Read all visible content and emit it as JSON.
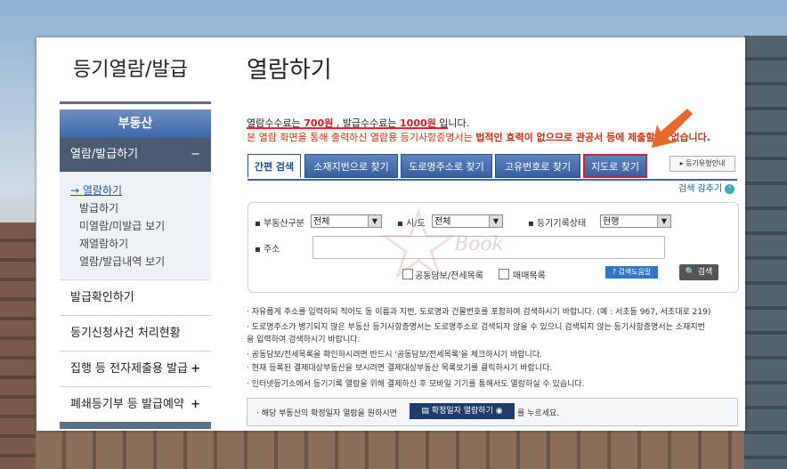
{
  "sidebar": {
    "title": "등기열람/발급",
    "header": "부동산",
    "active_item": "열람/발급하기",
    "active_toggle": "−",
    "sub_items": [
      "열람하기",
      "발급하기",
      "미열람/미발급 보기",
      "재열람하기",
      "열람/발급내역 보기"
    ],
    "items": [
      {
        "label": "발급확인하기",
        "toggle": ""
      },
      {
        "label": "등기신청사건 처리현황",
        "toggle": ""
      },
      {
        "label": "집행 등 전자제출용 발급",
        "toggle": "+"
      },
      {
        "label": "폐쇄등기부 등 발급예약",
        "toggle": "+"
      }
    ]
  },
  "main": {
    "title": "열람하기",
    "fee": {
      "p1": "열람수수료는 ",
      "v1": "700원",
      "p2": " , 발급수수료는 ",
      "v2": "1000원",
      "p3": " 입니다."
    },
    "notice": {
      "p1": "본 열람 화면을 통해 출력하신 열람용 등기사항증명서는 ",
      "b": "법적인 효력이 없으므로 관공서 등에 제출할 수 없습니다."
    },
    "tabs": [
      "간편 검색",
      "소재지번으로 찾기",
      "도로명주소로 찾기",
      "고유번호로 찾기",
      "지도로 찾기"
    ],
    "help_button": "등기유형안내",
    "collapse_label": "검색 감추기",
    "form": {
      "type_label": "부동산구분",
      "type_value": "전체",
      "city_label": "시/도",
      "city_value": "전체",
      "status_label": "등기기록상태",
      "status_value": "현행",
      "address_label": "주소",
      "address_value": "",
      "check1": "공동담보/전세목록",
      "check2": "매매목록",
      "guide_button": "검색도움말",
      "search_button": "검색"
    },
    "notes": [
      "· 자유롭게 주소를 입력하되 적어도 동 이름과 지번, 도로명과 건물번호를 포함하여 검색하시기 바랍니다. (예 : 서초동 967, 서초대로 219)",
      "· 도로명주소가 병기되지 않은 부동산 등기사항증명서는 도로명주소로 검색되지 않을 수 있으니 검색되지 않는 등기사항증명서는 소재지번",
      "  을 입력하여 검색하시기 바랍니다.",
      "· 공동담보/전세목록을 확인하시려면 반드시 '공동담보/전세목록'을 체크하시기 바랍니다.",
      "· 현재 등록된 결제대상부동산을 보시려면 결제대상부동산 목록보기를 클릭하시기 바랍니다.",
      "· 인터넷등기소에서 등기기록 열람을 위해 결제하신 후 모바일 기기를 통해서도 열람하실 수 있습니다."
    ],
    "bottom": {
      "p1": "· 해당 부동산의 확정일자 열람을 원하시면",
      "button": "확정일자 열람하기",
      "p2": "를 누르세요."
    },
    "watermark": "Book"
  }
}
